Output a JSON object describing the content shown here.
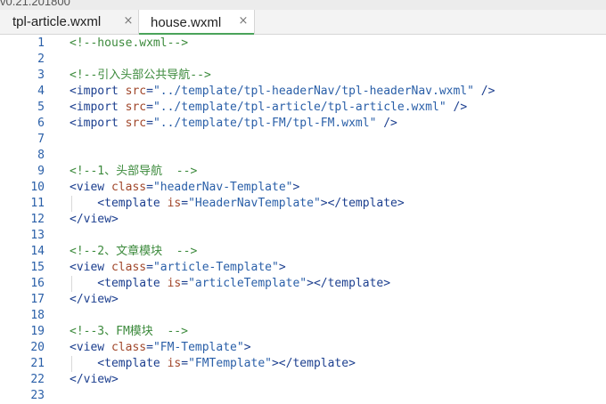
{
  "app": {
    "version": "v0.21.201800"
  },
  "tabs": [
    {
      "label": "tpl-article.wxml",
      "active": false,
      "close": "×"
    },
    {
      "label": "house.wxml",
      "active": true,
      "close": "×"
    }
  ],
  "editor": {
    "lines": [
      {
        "n": "1",
        "parts": [
          {
            "t": "comment",
            "v": "<!--house.wxml-->"
          }
        ]
      },
      {
        "n": "2",
        "parts": []
      },
      {
        "n": "3",
        "parts": [
          {
            "t": "comment",
            "v": "<!--引入头部公共导航-->"
          }
        ]
      },
      {
        "n": "4",
        "parts": [
          {
            "t": "tag",
            "v": "<import "
          },
          {
            "t": "attr",
            "v": "src"
          },
          {
            "t": "punct",
            "v": "="
          },
          {
            "t": "str",
            "v": "\"../template/tpl-headerNav/tpl-headerNav.wxml\""
          },
          {
            "t": "tag",
            "v": " />"
          }
        ]
      },
      {
        "n": "5",
        "parts": [
          {
            "t": "tag",
            "v": "<import "
          },
          {
            "t": "attr",
            "v": "src"
          },
          {
            "t": "punct",
            "v": "="
          },
          {
            "t": "str",
            "v": "\"../template/tpl-article/tpl-article.wxml\""
          },
          {
            "t": "tag",
            "v": " />"
          }
        ]
      },
      {
        "n": "6",
        "parts": [
          {
            "t": "tag",
            "v": "<import "
          },
          {
            "t": "attr",
            "v": "src"
          },
          {
            "t": "punct",
            "v": "="
          },
          {
            "t": "str",
            "v": "\"../template/tpl-FM/tpl-FM.wxml\""
          },
          {
            "t": "tag",
            "v": " />"
          }
        ]
      },
      {
        "n": "7",
        "parts": []
      },
      {
        "n": "8",
        "parts": []
      },
      {
        "n": "9",
        "parts": [
          {
            "t": "comment",
            "v": "<!--1、头部导航  -->"
          }
        ]
      },
      {
        "n": "10",
        "parts": [
          {
            "t": "tag",
            "v": "<view "
          },
          {
            "t": "attr",
            "v": "class"
          },
          {
            "t": "punct",
            "v": "="
          },
          {
            "t": "str",
            "v": "\"headerNav-Template\""
          },
          {
            "t": "tag",
            "v": ">"
          }
        ]
      },
      {
        "n": "11",
        "indent": true,
        "parts": [
          {
            "t": "tag",
            "v": "    <template "
          },
          {
            "t": "attr",
            "v": "is"
          },
          {
            "t": "punct",
            "v": "="
          },
          {
            "t": "str",
            "v": "\"HeaderNavTemplate\""
          },
          {
            "t": "tag",
            "v": "></template>"
          }
        ]
      },
      {
        "n": "12",
        "parts": [
          {
            "t": "tag",
            "v": "</view>"
          }
        ]
      },
      {
        "n": "13",
        "parts": []
      },
      {
        "n": "14",
        "parts": [
          {
            "t": "comment",
            "v": "<!--2、文章模块  -->"
          }
        ]
      },
      {
        "n": "15",
        "parts": [
          {
            "t": "tag",
            "v": "<view "
          },
          {
            "t": "attr",
            "v": "class"
          },
          {
            "t": "punct",
            "v": "="
          },
          {
            "t": "str",
            "v": "\"article-Template\""
          },
          {
            "t": "tag",
            "v": ">"
          }
        ]
      },
      {
        "n": "16",
        "indent": true,
        "parts": [
          {
            "t": "tag",
            "v": "    <template "
          },
          {
            "t": "attr",
            "v": "is"
          },
          {
            "t": "punct",
            "v": "="
          },
          {
            "t": "str",
            "v": "\"articleTemplate\""
          },
          {
            "t": "tag",
            "v": "></template>"
          }
        ]
      },
      {
        "n": "17",
        "parts": [
          {
            "t": "tag",
            "v": "</view>"
          }
        ]
      },
      {
        "n": "18",
        "parts": []
      },
      {
        "n": "19",
        "parts": [
          {
            "t": "comment",
            "v": "<!--3、FM模块  -->"
          }
        ]
      },
      {
        "n": "20",
        "parts": [
          {
            "t": "tag",
            "v": "<view "
          },
          {
            "t": "attr",
            "v": "class"
          },
          {
            "t": "punct",
            "v": "="
          },
          {
            "t": "str",
            "v": "\"FM-Template\""
          },
          {
            "t": "tag",
            "v": ">"
          }
        ]
      },
      {
        "n": "21",
        "indent": true,
        "parts": [
          {
            "t": "tag",
            "v": "    <template "
          },
          {
            "t": "attr",
            "v": "is"
          },
          {
            "t": "punct",
            "v": "="
          },
          {
            "t": "str",
            "v": "\"FMTemplate\""
          },
          {
            "t": "tag",
            "v": "></template>"
          }
        ]
      },
      {
        "n": "22",
        "parts": [
          {
            "t": "tag",
            "v": "</view>"
          }
        ]
      },
      {
        "n": "23",
        "parts": []
      }
    ]
  },
  "colors": {
    "comment": "#3c8a3c",
    "tag": "#1c3f8f",
    "attribute": "#a0462a",
    "string": "#2a5fa8",
    "line_number": "#2a5fa8",
    "active_tab_underline": "#4aa35a"
  },
  "icons": {
    "tab_close": "close-icon"
  }
}
